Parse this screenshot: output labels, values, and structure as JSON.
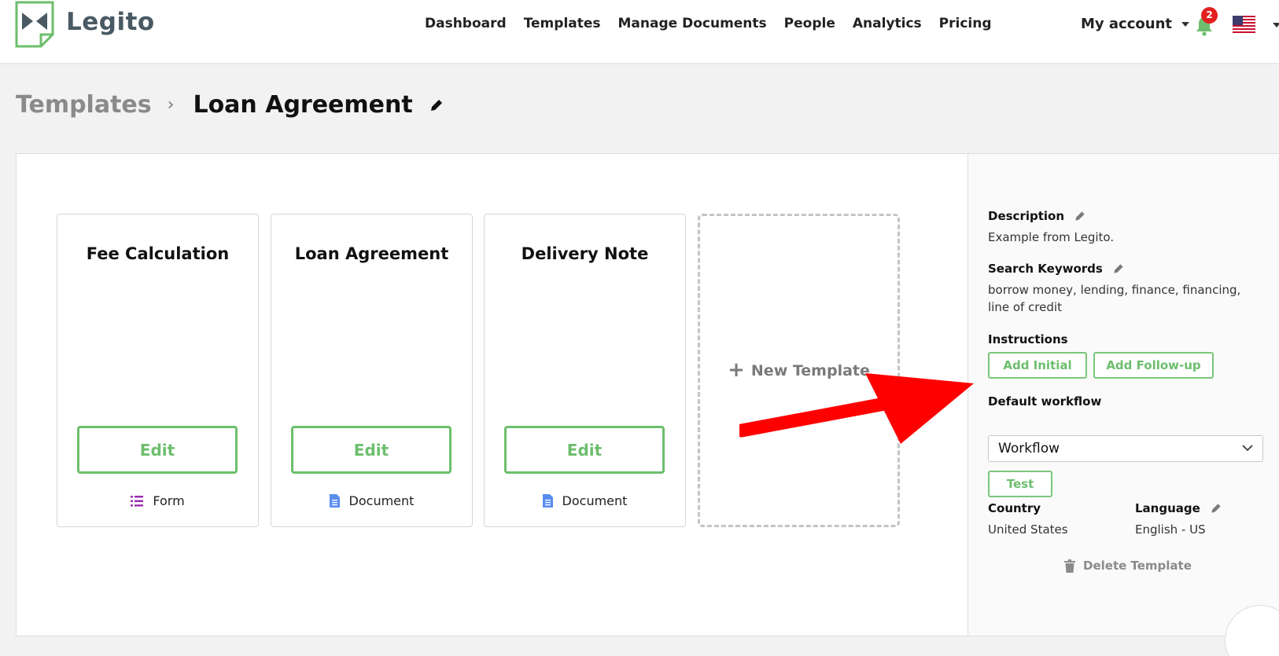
{
  "app": {
    "name": "Legito"
  },
  "nav": {
    "items": [
      "Dashboard",
      "Templates",
      "Manage Documents",
      "People",
      "Analytics",
      "Pricing"
    ]
  },
  "header": {
    "account_label": "My account",
    "notification_count": "2"
  },
  "breadcrumb": {
    "parent": "Templates",
    "separator": "›",
    "current": "Loan Agreement"
  },
  "cards": [
    {
      "title": "Fee Calculation",
      "edit_label": "Edit",
      "type": "Form",
      "type_icon": "list-icon"
    },
    {
      "title": "Loan Agreement",
      "edit_label": "Edit",
      "type": "Document",
      "type_icon": "document-icon"
    },
    {
      "title": "Delivery Note",
      "edit_label": "Edit",
      "type": "Document",
      "type_icon": "document-icon"
    }
  ],
  "new_template": {
    "plus": "+",
    "label": "New Template"
  },
  "side": {
    "description_label": "Description",
    "description_value": "Example from Legito.",
    "keywords_label": "Search Keywords",
    "keywords_value": "borrow money, lending, finance, financing, line of credit",
    "instructions_label": "Instructions",
    "add_initial": "Add Initial",
    "add_followup": "Add Follow-up",
    "workflow_label": "Default workflow",
    "workflow_value": "Workflow",
    "test_label": "Test",
    "country_label": "Country",
    "country_value": "United States",
    "language_label": "Language",
    "language_value": "English - US",
    "delete_label": "Delete Template"
  },
  "colors": {
    "accent_green": "#6dbe6d",
    "badge_red": "#e32020",
    "arrow_red": "#ff0000",
    "form_icon": "#9b27b0",
    "doc_icon": "#5b8def"
  }
}
